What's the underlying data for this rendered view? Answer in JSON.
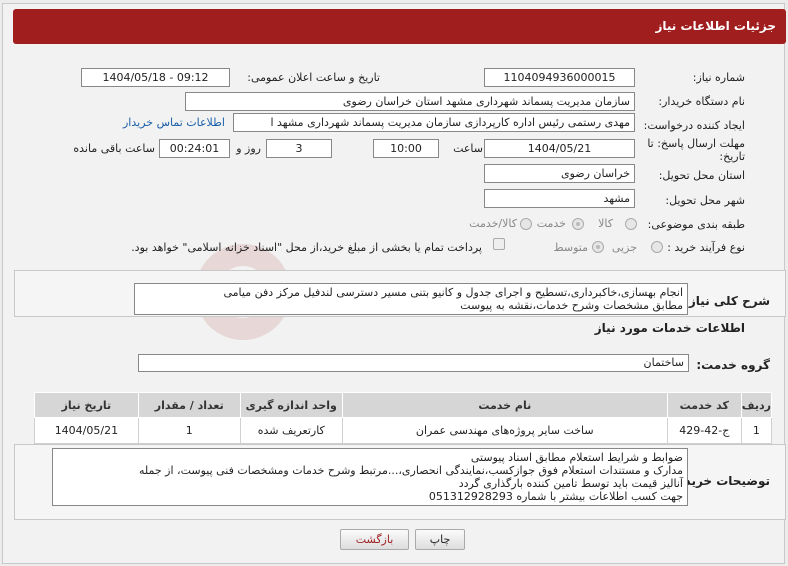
{
  "header": {
    "title": "جزئیات اطلاعات نیاز"
  },
  "fields": {
    "need_number_label": "شماره نیاز:",
    "need_number": "1104094936000015",
    "announce_label": "تاریخ و ساعت اعلان عمومی:",
    "announce_value": "1404/05/18 - 09:12",
    "buyer_org_label": "نام دستگاه خریدار:",
    "buyer_org": "سازمان مدیریت پسماند شهرداری مشهد استان خراسان رضوی",
    "creator_label": "ایجاد کننده درخواست:",
    "creator": "مهدی رستمی رئیس اداره کارپردازی سازمان مدیریت پسماند شهرداری مشهد ا",
    "contact_link": "اطلاعات تماس خریدار",
    "deadline_label": "مهلت ارسال پاسخ: تا تاریخ:",
    "deadline_date": "1404/05/21",
    "time_label": "ساعت",
    "deadline_time": "10:00",
    "days": "3",
    "days_label": "روز و",
    "remaining": "00:24:01",
    "remaining_label": "ساعت باقی مانده",
    "province_label": "استان محل تحویل:",
    "province": "خراسان رضوی",
    "city_label": "شهر محل تحویل:",
    "city": "مشهد",
    "category_label": "طبقه بندی موضوعی:",
    "category_options": [
      "کالا",
      "خدمت",
      "کالا/خدمت"
    ],
    "category_selected": "خدمت",
    "process_label": "نوع فرآیند خرید :",
    "process_options": [
      "جزیی",
      "متوسط"
    ],
    "process_selected": "متوسط",
    "payment_note": "پرداخت تمام یا بخشی از مبلغ خرید،از محل \"اسناد خزانه اسلامی\" خواهد بود."
  },
  "summary": {
    "label": "شرح کلی نیاز:",
    "text_line1": "انجام بهسازی،خاکبرداری،تسطیح و اجرای جدول و کانیو بتنی مسیر دسترسی لندفیل  مرکز دفن میامی",
    "text_line2": "مطابق مشخصات وشرح خدمات،نقشه به پیوست"
  },
  "services": {
    "title": "اطلاعات خدمات مورد نیاز",
    "group_label": "گروه خدمت:",
    "group_value": "ساختمان",
    "columns": [
      "ردیف",
      "کد خدمت",
      "نام خدمت",
      "واحد اندازه گیری",
      "تعداد / مقدار",
      "تاریخ نیاز"
    ],
    "rows": [
      [
        "1",
        "ج-42-429",
        "ساخت سایر پروژه‌های مهندسی عمران",
        "کارتعریف شده",
        "1",
        "1404/05/21"
      ]
    ]
  },
  "buyer_notes": {
    "label": "توضیحات خریدار:",
    "line1": "ضوابط و شرایط استعلام مطابق اسناد پیوستی",
    "line2": "مدارک و مستندات استعلام فوق جوازکسب،نمایندگی انحصاری،...مرتبط وشرح خدمات ومشخصات فنی پیوست، از جمله",
    "line3": "آنالیز قیمت باید توسط تامین کننده بارگذاری گردد",
    "line4": "جهت کسب اطلاعات بیشتر با شماره 051312928293"
  },
  "buttons": {
    "print": "چاپ",
    "back": "بازگشت"
  },
  "colors": {
    "header_bg": "#a01e1e",
    "link": "#1a5ea8",
    "back_text": "#a01e1e"
  }
}
